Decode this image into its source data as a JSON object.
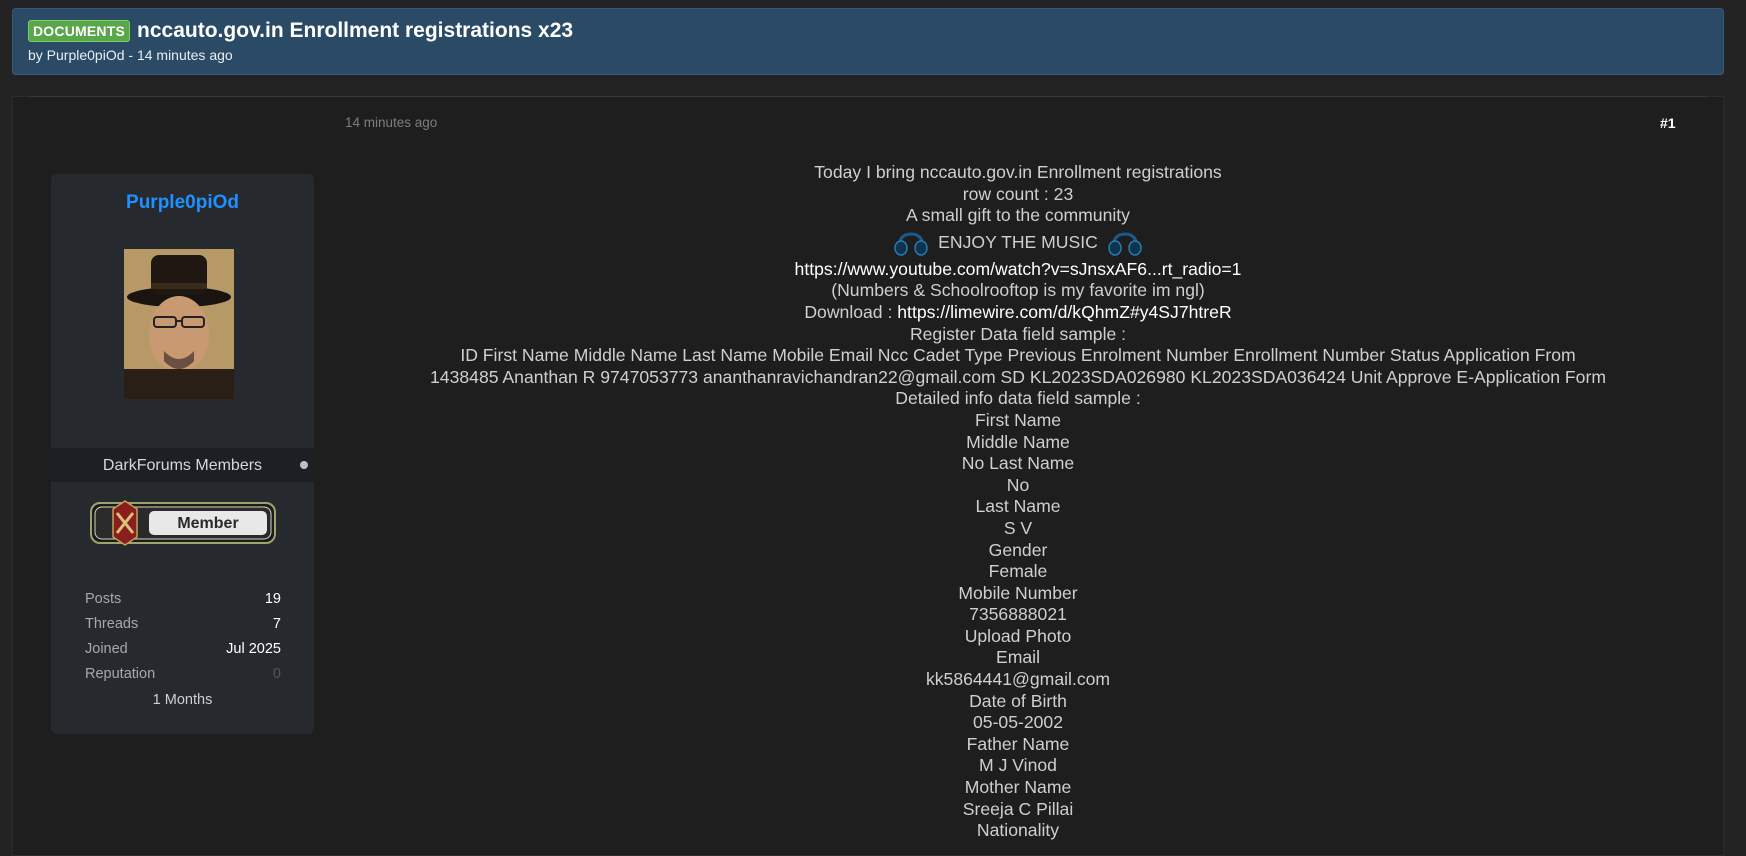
{
  "thread": {
    "prefix": "DOCUMENTS",
    "title": "nccauto.gov.in Enrollment registrations x23",
    "meta": "by Purple0piOd - 14 minutes ago"
  },
  "user": {
    "name": "Purple0piOd",
    "usergroup": "DarkForums Members",
    "rank": "Member",
    "stats": [
      {
        "label": "Posts",
        "value": "19"
      },
      {
        "label": "Threads",
        "value": "7"
      },
      {
        "label": "Joined",
        "value": "Jul 2025"
      },
      {
        "label": "Reputation",
        "value": "0"
      }
    ],
    "membership": "1 Months"
  },
  "post": {
    "date": "14 minutes ago",
    "number": "#1",
    "intro_1": "Today I bring nccauto.gov.in Enrollment registrations",
    "intro_2": "row count : 23",
    "intro_3": "A small gift to the community",
    "music_label": "ENJOY THE MUSIC",
    "youtube_link": "https://www.youtube.com/watch?v=sJnsxAF6...rt_radio=1",
    "music_note": "(Numbers & Schoolrooftop is my favorite im ngl)",
    "download_label": "Download :",
    "download_link": "https://limewire.com/d/kQhmZ#y4SJ7htreR",
    "register_heading": "Register Data field sample :",
    "register_header": "ID First Name Middle Name Last Name Mobile Email Ncc Cadet Type Previous Enrolment Number Enrollment Number Status Application From",
    "register_row": "1438485 Ananthan R 9747053773 ananthanravichandran22@gmail.com SD KL2023SDA026980 KL2023SDA036424 Unit Approve E-Application Form",
    "detail_heading": "Detailed info data field sample :",
    "detail_lines": [
      "First Name",
      "Middle Name",
      "No Last Name",
      "No",
      "Last Name",
      "S V",
      "Gender",
      "Female",
      "Mobile Number",
      "7356888021",
      "Upload Photo",
      "Email",
      "kk5864441@gmail.com",
      "Date of Birth",
      "05-05-2002",
      "Father Name",
      "M J Vinod",
      "Mother Name",
      "Sreeja C Pillai",
      "Nationality"
    ]
  },
  "icons": {
    "headphones_left": "headphones-icon",
    "headphones_right": "headphones-icon",
    "status": "offline-dot-icon"
  },
  "colors": {
    "header_bg": "#2b4a66",
    "prefix_bg": "#5aa64a",
    "username": "#1e90ff",
    "page_bg": "#232323"
  }
}
